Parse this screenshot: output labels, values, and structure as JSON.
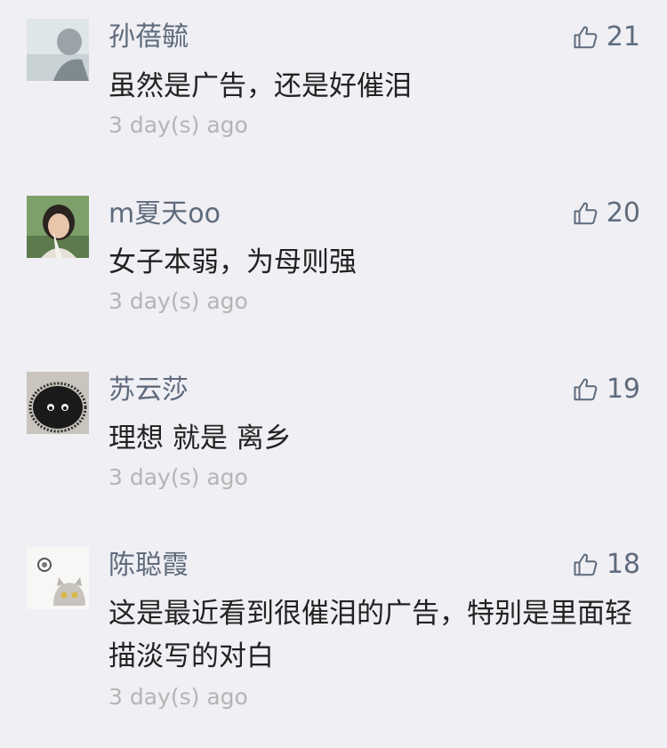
{
  "comments": [
    {
      "nickname": "孙蓓毓",
      "content": "虽然是广告，还是好催泪",
      "time": "3 day(s) ago",
      "likes": "21",
      "avatar_icon": "user-avatar-icon"
    },
    {
      "nickname": "m夏天oo",
      "content": "女子本弱，为母则强",
      "time": "3 day(s) ago",
      "likes": "20",
      "avatar_icon": "user-avatar-icon"
    },
    {
      "nickname": "苏云莎",
      "content": "理想 就是 离乡",
      "time": "3 day(s) ago",
      "likes": "19",
      "avatar_icon": "user-avatar-icon"
    },
    {
      "nickname": "陈聪霞",
      "content": "这是最近看到很催泪的广告，特别是里面轻描淡写的对白",
      "time": "3 day(s) ago",
      "likes": "18",
      "avatar_icon": "user-avatar-icon"
    }
  ],
  "like_icon": "thumbs-up-icon",
  "colors": {
    "background": "#efeff4",
    "nickname": "#5f6b7c",
    "content": "#222222",
    "time": "#b5b5b5"
  }
}
